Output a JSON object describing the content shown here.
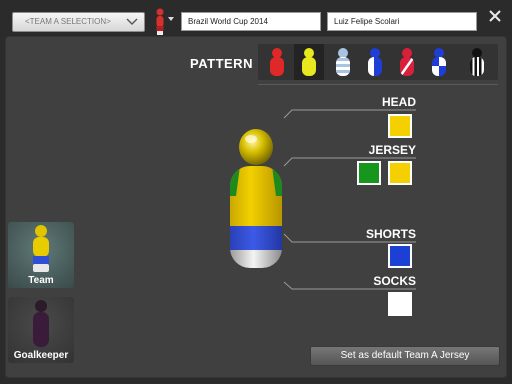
{
  "header": {
    "team_select": {
      "value": "<TEAM A SELECTION>",
      "icon": "chevron-down-icon"
    },
    "competition_field": "Brazil World Cup 2014",
    "coach_field": "Luiz Felipe Scolari",
    "close_icon": "close-icon"
  },
  "pattern": {
    "label": "PATTERN",
    "options": [
      {
        "name": "solid-red",
        "colors": [
          "#e02828"
        ]
      },
      {
        "name": "solid-yellow",
        "colors": [
          "#e8e820"
        ],
        "selected": true
      },
      {
        "name": "light-blue-stripes",
        "colors": [
          "#a9c4e0",
          "#ffffff"
        ]
      },
      {
        "name": "blue-white-half",
        "colors": [
          "#1d3fd8",
          "#ffffff"
        ]
      },
      {
        "name": "red-sash",
        "colors": [
          "#d8203a",
          "#ffffff"
        ]
      },
      {
        "name": "blue-white-quarters",
        "colors": [
          "#1d3fd8",
          "#ffffff"
        ]
      },
      {
        "name": "black-white-stripes",
        "colors": [
          "#111111",
          "#ffffff"
        ]
      }
    ]
  },
  "sections": {
    "head": {
      "label": "HEAD",
      "colors": [
        "#f5d000"
      ]
    },
    "jersey": {
      "label": "JERSEY",
      "colors": [
        "#16961c",
        "#f5d000"
      ]
    },
    "shorts": {
      "label": "SHORTS",
      "colors": [
        "#1c3fd6"
      ]
    },
    "socks": {
      "label": "SOCKS",
      "colors": [
        "#ffffff"
      ]
    }
  },
  "thumbnails": {
    "team": {
      "label": "Team"
    },
    "goalkeeper": {
      "label": "Goalkeeper"
    }
  },
  "footer": {
    "default_button": "Set as default Team A Jersey"
  }
}
